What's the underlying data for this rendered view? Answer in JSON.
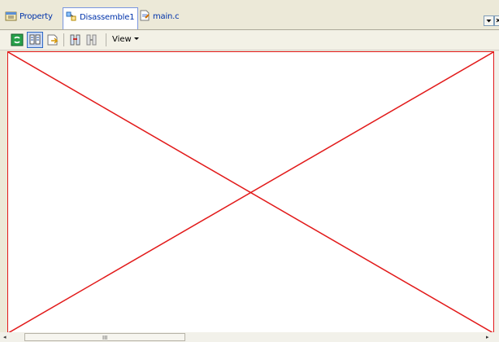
{
  "tabs": [
    {
      "label": "Property",
      "icon": "property-sheet-icon",
      "active": false
    },
    {
      "label": "Disassemble1",
      "icon": "disassembly-icon",
      "active": true
    },
    {
      "label": "main.c",
      "icon": "source-file-icon",
      "active": false
    }
  ],
  "toolbar": {
    "view_label": "View"
  },
  "colors": {
    "canvas_border": "#e21a1a",
    "cross": "#e21a1a",
    "tab_text": "#0033aa"
  },
  "scrollbar": {
    "h_grip": "III",
    "left_arrow": "◂",
    "right_arrow": "▸"
  }
}
